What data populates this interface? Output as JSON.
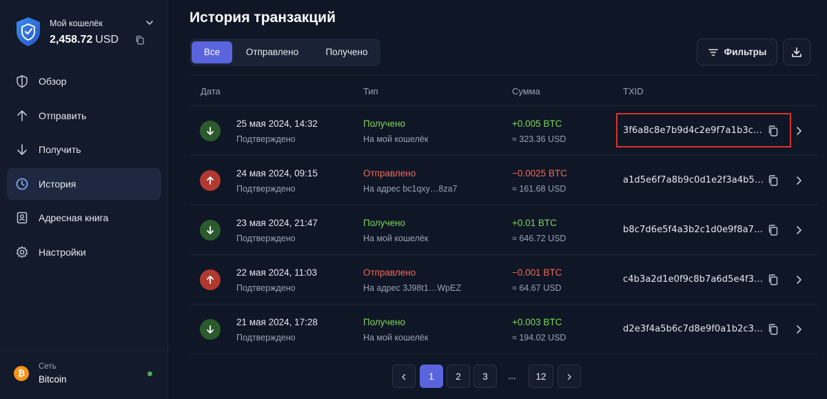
{
  "sidebar": {
    "wallet": {
      "name": "Мой кошелёк",
      "balance": "2,458.72",
      "currency": "USD"
    },
    "nav": [
      {
        "label": "Обзор",
        "icon": "shield-icon"
      },
      {
        "label": "Отправить",
        "icon": "arrow-up-icon"
      },
      {
        "label": "Получить",
        "icon": "arrow-down-icon"
      },
      {
        "label": "История",
        "icon": "clock-icon",
        "active": true
      },
      {
        "label": "Адресная книга",
        "icon": "contacts-icon"
      },
      {
        "label": "Настройки",
        "icon": "gear-icon"
      }
    ],
    "network": {
      "label": "Сеть",
      "value": "Bitcoin",
      "icon": "bitcoin-icon",
      "status_color": "#4caf50"
    }
  },
  "main": {
    "title": "История транзакций",
    "tabs": [
      {
        "label": "Все",
        "active": true
      },
      {
        "label": "Отправлено"
      },
      {
        "label": "Получено"
      }
    ],
    "filter_label": "Фильтры",
    "download_icon": "download-icon",
    "columns": {
      "date": "Дата",
      "type": "Тип",
      "amount": "Сумма",
      "txid": "TXID"
    },
    "rows": [
      {
        "direction": "in",
        "date": "25 мая 2024, 14:32",
        "status": "Подтверждено",
        "type": "Получено",
        "type_sub": "На мой кошелёк",
        "amount": "+0.005 BTC",
        "fiat": "≈ 323.36 USD",
        "txid": "3f6a8c8e7b9d4c2e9f7a1b3c…"
      },
      {
        "direction": "out",
        "date": "24 мая 2024, 09:15",
        "status": "Подтверждено",
        "type": "Отправлено",
        "type_sub": "На адрес bc1qxy…8za7",
        "amount": "−0.0025 BTC",
        "fiat": "≈ 161.68 USD",
        "txid": "a1d5e6f7a8b9c0d1e2f3a4b5…"
      },
      {
        "direction": "in",
        "date": "23 мая 2024, 21:47",
        "status": "Подтверждено",
        "type": "Получено",
        "type_sub": "На мой кошелёк",
        "amount": "+0.01 BTC",
        "fiat": "≈ 646.72 USD",
        "txid": "b8c7d6e5f4a3b2c1d0e9f8a7…"
      },
      {
        "direction": "out",
        "date": "22 мая 2024, 11:03",
        "status": "Подтверждено",
        "type": "Отправлено",
        "type_sub": "На адрес 3J98t1…WpEZ",
        "amount": "−0.001 BTC",
        "fiat": "≈ 64.67 USD",
        "txid": "c4b3a2d1e0f9c8b7a6d5e4f3…"
      },
      {
        "direction": "in",
        "date": "21 мая 2024, 17:28",
        "status": "Подтверждено",
        "type": "Получено",
        "type_sub": "На мой кошелёк",
        "amount": "+0.003 BTC",
        "fiat": "≈ 194.02 USD",
        "txid": "d2e3f4a5b6c7d8e9f0a1b2c3…"
      }
    ]
  },
  "pagination": {
    "pages": [
      "1",
      "2",
      "3"
    ],
    "ellipsis": "...",
    "last": "12",
    "current": "1"
  },
  "colors": {
    "accent": "#5964dd",
    "received": "#7ed957",
    "sent": "#f06a5a",
    "highlight": "#d9342b"
  }
}
